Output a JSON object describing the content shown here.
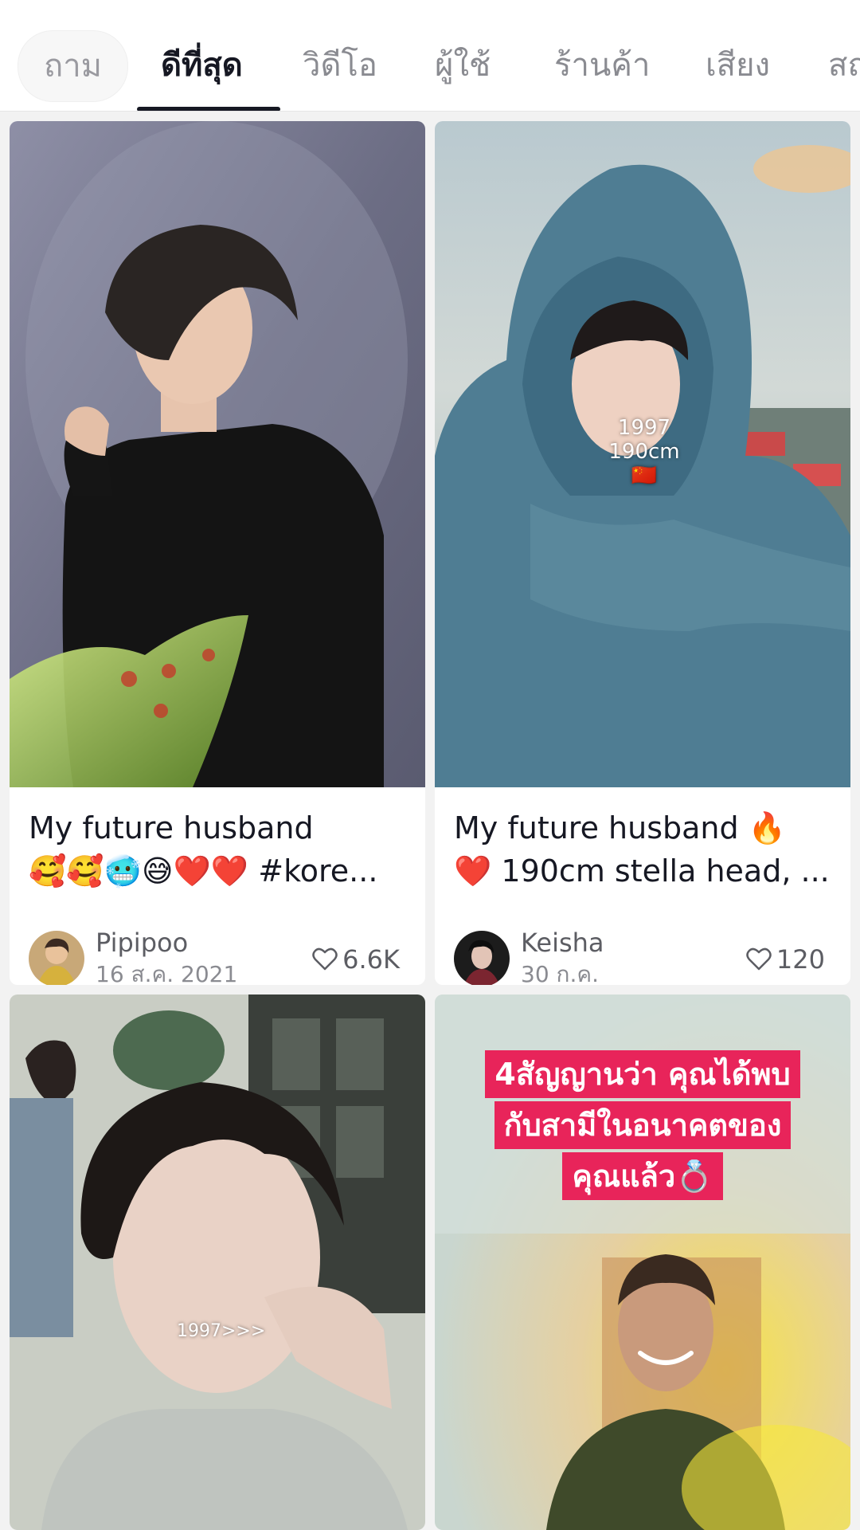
{
  "tabs": [
    {
      "label": "ถาม"
    },
    {
      "label": "ดีที่สุด"
    },
    {
      "label": "วิดีโอ"
    },
    {
      "label": "ผู้ใช้"
    },
    {
      "label": "ร้านค้า"
    },
    {
      "label": "เสียง"
    },
    {
      "label": "สถ"
    }
  ],
  "active_tab_index": 1,
  "cards": [
    {
      "caption_line1": "My future husband",
      "caption_line2": "🥰🥰🥶😅❤️❤️ #kore...",
      "author": "Pipipoo",
      "date": "16 ส.ค. 2021",
      "likes": "6.6K"
    },
    {
      "caption_line1": "My future husband 🔥",
      "caption_line2": "❤️ 190cm stella head, ...",
      "author": "Keisha",
      "date": "30 ก.ค.",
      "likes": "120",
      "overlay_line1": "1997",
      "overlay_line2": "190cm",
      "overlay_flag": "🇨🇳"
    },
    {
      "overlay_text": "1997>>>"
    },
    {
      "banner_line1": "4สัญญานว่า คุณได้พบ",
      "banner_line2": "กับสามีในอนาคตของ",
      "banner_line3": "คุณแล้ว💍"
    }
  ],
  "colors": {
    "accent_banner": "#e8245a",
    "text_primary": "#161823",
    "text_secondary": "#8a8b91"
  },
  "icons": {
    "like": "heart-outline-icon",
    "sound": "speaker-icon"
  }
}
